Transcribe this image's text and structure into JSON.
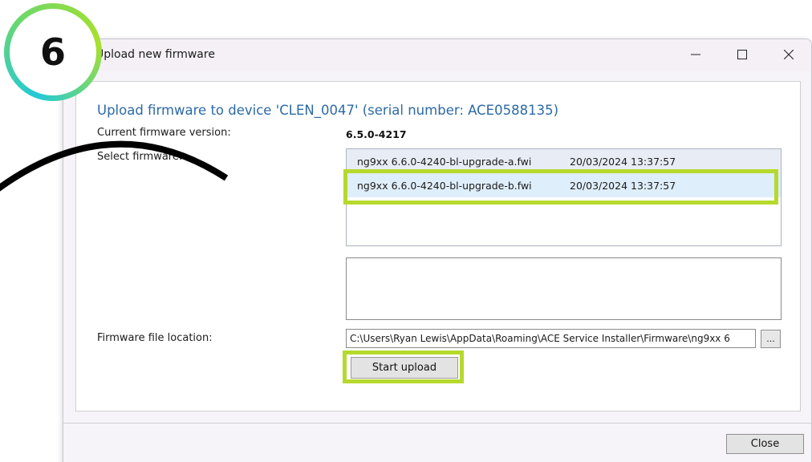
{
  "window": {
    "title": "Upload new firmware",
    "controls": {
      "minimize": "minimize-icon",
      "maximize": "maximize-icon",
      "close": "close-icon"
    }
  },
  "main": {
    "heading": "Upload firmware to device 'CLEN_0047' (serial number: ACE0588135)",
    "current_label": "Current firmware version:",
    "current_value": "6.5.0-4217",
    "select_label": "Select firmware:",
    "firmware_list": [
      {
        "name": "ng9xx 6.6.0-4240-bl-upgrade-a.fwi",
        "date": "20/03/2024 13:37:57"
      },
      {
        "name": "ng9xx 6.6.0-4240-bl-upgrade-b.fwi",
        "date": "20/03/2024 13:37:57",
        "selected": true
      }
    ],
    "location_label": "Firmware file location:",
    "location_value": "C:\\Users\\Ryan Lewis\\AppData\\Roaming\\ACE Service Installer\\Firmware\\ng9xx 6",
    "browse_label": "...",
    "start_label": "Start upload"
  },
  "footer": {
    "close_label": "Close"
  },
  "overlay": {
    "step_number": "6",
    "highlight_color": "#b6d92d",
    "badge_gradient": [
      "#23c9d8",
      "#a9e02c"
    ]
  }
}
